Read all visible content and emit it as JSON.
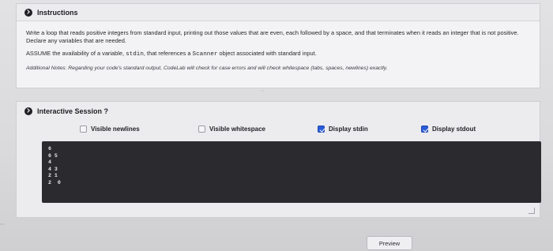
{
  "instructions": {
    "title": "Instructions",
    "p1": "Write a loop that reads positive integers from standard input, printing out those values that are even, each followed by a space, and that terminates when it reads an integer that is not positive. Declare any variables that are needed.",
    "p2_prefix": "ASSUME the availability of a variable, ",
    "p2_code1": "stdin",
    "p2_mid": ", that references a ",
    "p2_code2": "Scanner",
    "p2_suffix": " object associated with standard input.",
    "p3": "Additional Notes: Regarding your code's standard output, CodeLab will check for case errors and will check whitespace (tabs, spaces, newlines) exactly."
  },
  "session": {
    "title": "Interactive Session ?",
    "options": [
      {
        "label": "Visible newlines",
        "checked": false
      },
      {
        "label": "Visible whitespace",
        "checked": false
      },
      {
        "label": "Display stdin",
        "checked": true
      },
      {
        "label": "Display stdout",
        "checked": true
      }
    ],
    "terminal_lines": [
      "6",
      "6 5",
      "4",
      "4 3",
      "2 1",
      "2  0"
    ]
  },
  "preview_label": "Preview",
  "colors": {
    "accent": "#2a5bd7",
    "terminal_bg": "#2b2b2f"
  }
}
